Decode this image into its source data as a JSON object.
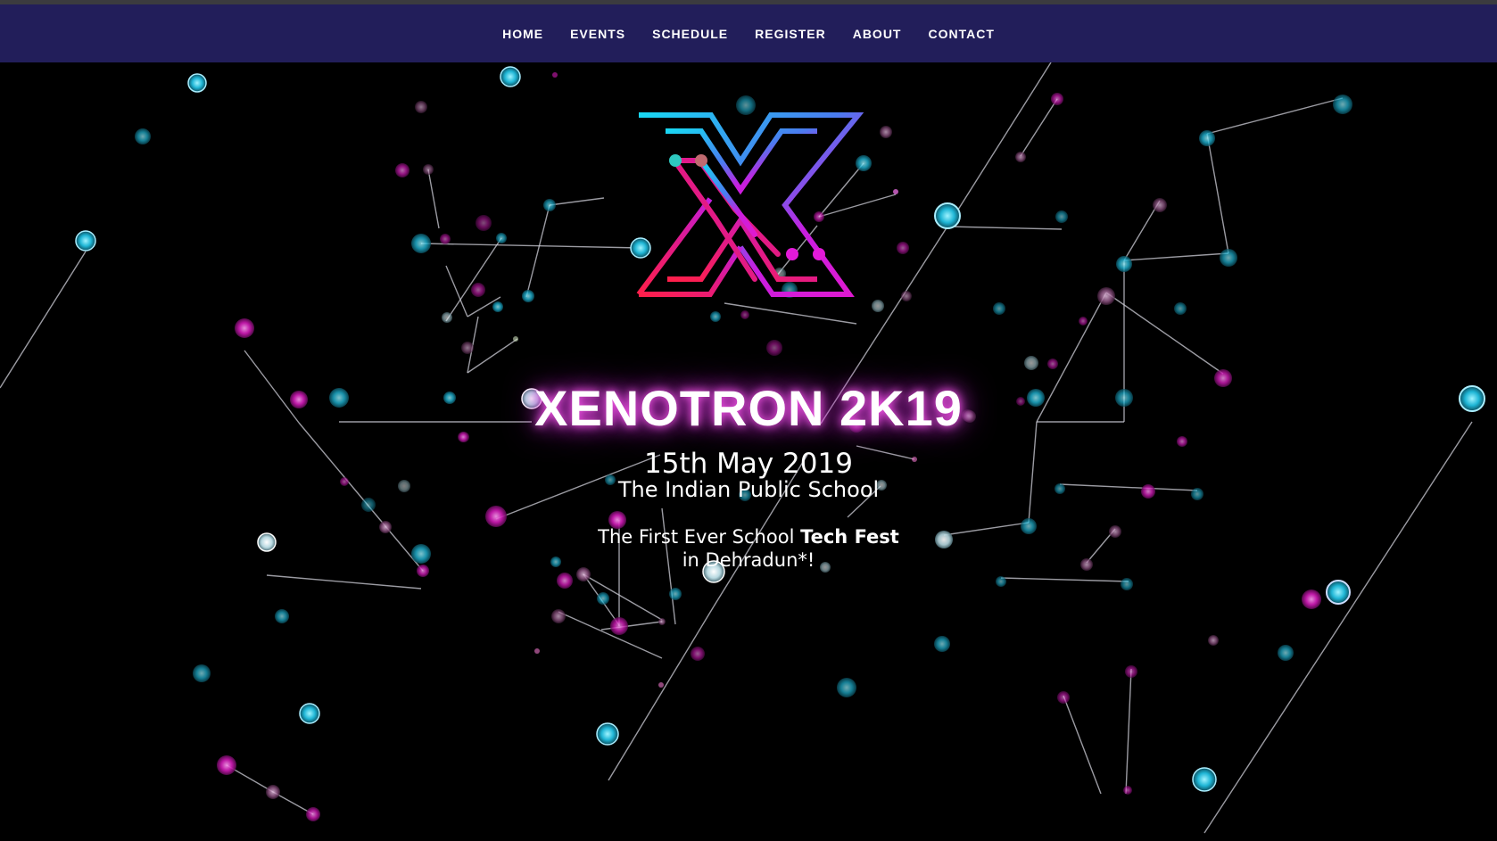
{
  "nav": {
    "items": [
      "HOME",
      "EVENTS",
      "SCHEDULE",
      "REGISTER",
      "ABOUT",
      "CONTACT"
    ]
  },
  "hero": {
    "title": "XENOTRON 2K19",
    "date": "15th May 2019",
    "school": "The Indian Public School",
    "tagline_part1": "The First Ever School ",
    "tagline_bold": "Tech Fest",
    "tagline_line2": "in Dehradun*!"
  },
  "colors": {
    "nav_bg": "#221e5a",
    "accent_cyan": "#22d3f0",
    "accent_magenta": "#e020c8",
    "accent_red": "#ff2a55"
  },
  "icons": {
    "logo": "xenotron-x-logo"
  }
}
